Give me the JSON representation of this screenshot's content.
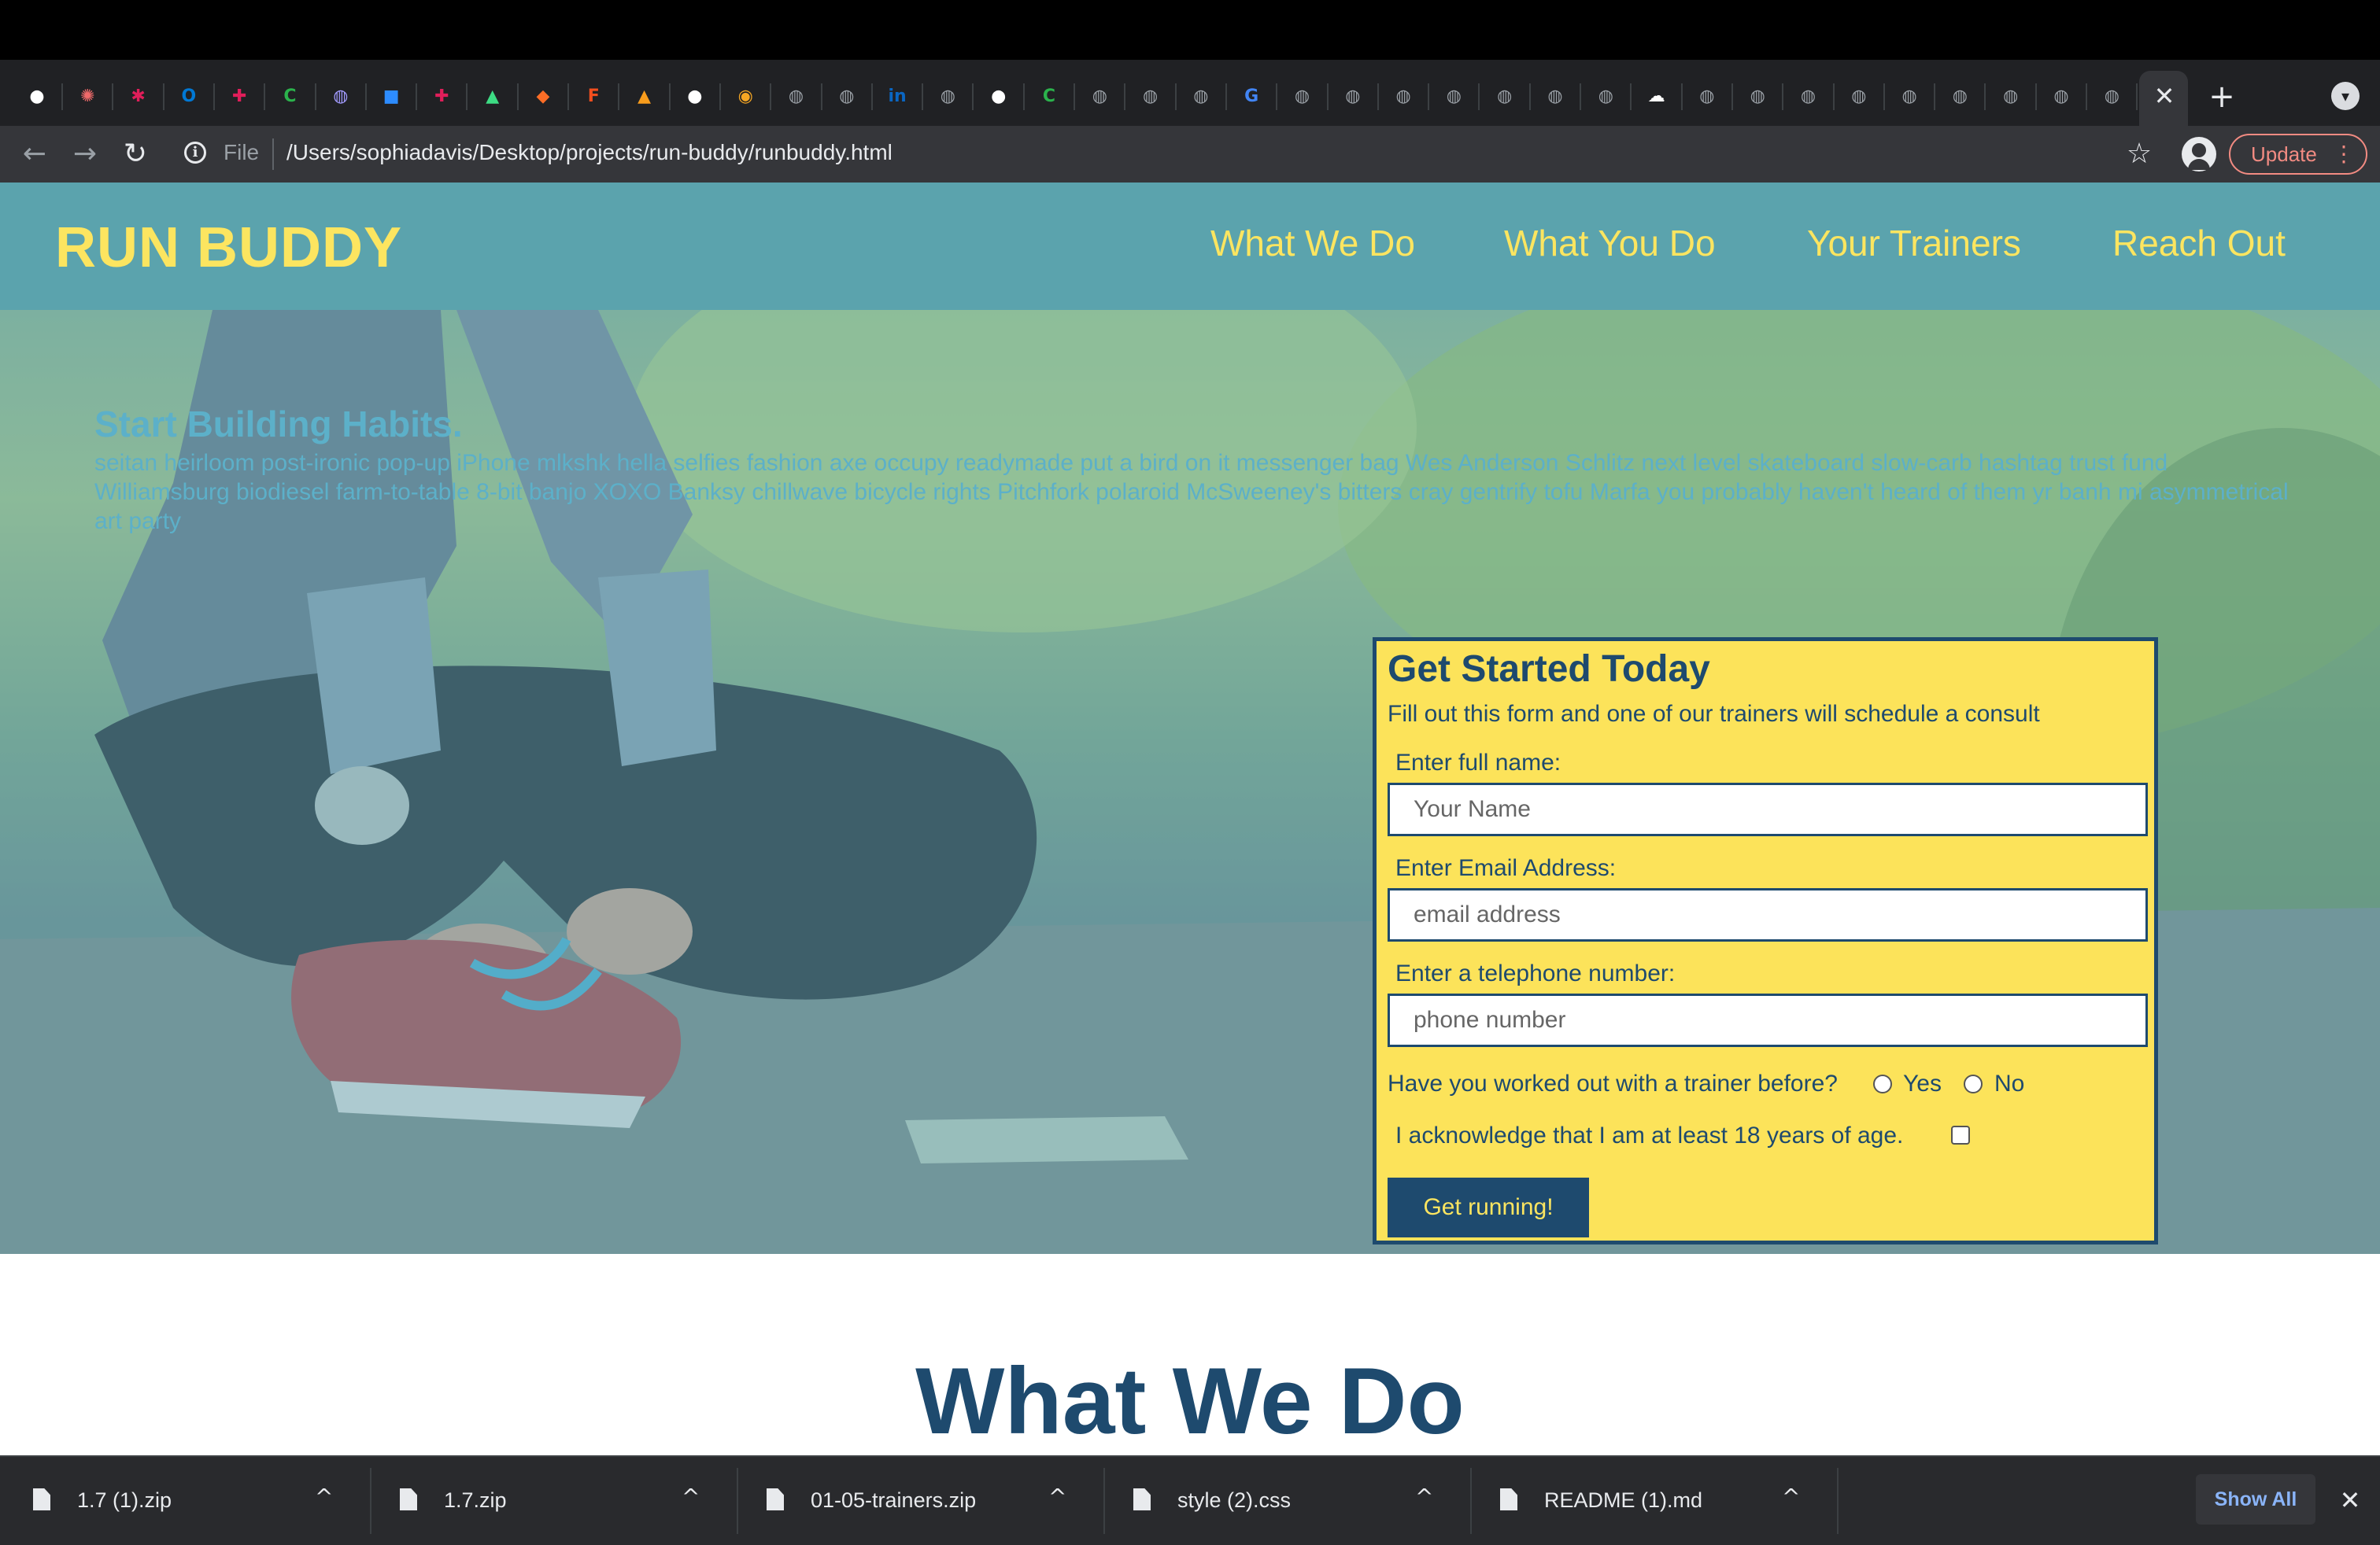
{
  "browser": {
    "tab_icons": [
      "github-icon",
      "asana-icon",
      "asterisk-icon",
      "outlook-icon",
      "slack-icon",
      "c-icon",
      "globe-icon",
      "zoom-icon",
      "slack-icon",
      "android-icon",
      "gitlab-icon",
      "figma-icon",
      "box-icon",
      "github-icon",
      "badge-icon",
      "globe-icon",
      "globe-icon",
      "linkedin-icon",
      "globe-icon",
      "github-icon",
      "c-icon",
      "globe-icon",
      "globe-icon",
      "globe-icon",
      "google-icon",
      "globe-icon",
      "globe-icon",
      "globe-icon",
      "globe-icon",
      "globe-icon",
      "globe-icon",
      "globe-icon",
      "cloud-icon",
      "globe-icon",
      "globe-icon",
      "globe-icon",
      "globe-icon",
      "globe-icon",
      "globe-icon",
      "globe-icon",
      "globe-icon",
      "globe-icon"
    ],
    "tab_colors": [
      "#ffffff",
      "#f06a6a",
      "#e01e5a",
      "#0078d4",
      "#e01e5a",
      "#2bb24c",
      "#a29bfe",
      "#2d8cff",
      "#e01e5a",
      "#3ddc84",
      "#fc6d26",
      "#f24e1e",
      "#f89c1c",
      "#ffffff",
      "#f5a623",
      "#9aa0a6",
      "#9aa0a6",
      "#0a66c2",
      "#9aa0a6",
      "#ffffff",
      "#2bb24c",
      "#9aa0a6",
      "#9aa0a6",
      "#9aa0a6",
      "#4285f4",
      "#9aa0a6",
      "#9aa0a6",
      "#9aa0a6",
      "#9aa0a6",
      "#9aa0a6",
      "#9aa0a6",
      "#9aa0a6",
      "#ffffff",
      "#9aa0a6",
      "#9aa0a6",
      "#9aa0a6",
      "#9aa0a6",
      "#9aa0a6",
      "#9aa0a6",
      "#9aa0a6",
      "#9aa0a6",
      "#9aa0a6"
    ],
    "file_label": "File",
    "url": "/Users/sophiadavis/Desktop/projects/run-buddy/runbuddy.html",
    "update_label": "Update"
  },
  "site": {
    "logo": "RUN BUDDY",
    "nav": [
      "What We Do",
      "What You Do",
      "Your Trainers",
      "Reach Out"
    ]
  },
  "hero": {
    "title": "Start Building Habits.",
    "text": "seitan heirloom post-ironic pop-up iPhone mlkshk hella selfies fashion axe occupy readymade put a bird on it messenger bag Wes Anderson Schlitz next level skateboard slow-carb hashtag trust fund Williamsburg biodiesel farm-to-table 8-bit banjo XOXO Banksy chillwave bicycle rights Pitchfork polaroid McSweeney's bitters cray gentrify tofu Marfa you probably haven't heard of them yr banh mi asymmetrical art party"
  },
  "form": {
    "title": "Get Started Today",
    "subtitle": "Fill out this form and one of our trainers will schedule a consult",
    "name_label": "Enter full name:",
    "name_placeholder": "Your Name",
    "email_label": "Enter Email Address:",
    "email_placeholder": "email address",
    "phone_label": "Enter a telephone number:",
    "phone_placeholder": "phone number",
    "trainer_question": "Have you worked out with a trainer before?",
    "yes_label": "Yes",
    "no_label": "No",
    "ack_label": "I acknowledge that I am at least 18 years of age.",
    "submit_label": "Get running!"
  },
  "section": {
    "title": "What We Do"
  },
  "downloads": {
    "items": [
      "1.7 (1).zip",
      "1.7.zip",
      "01-05-trainers.zip",
      "style (2).css",
      "README (1).md"
    ],
    "show_all": "Show All"
  },
  "colors": {
    "header_bg": "#5ba3ad",
    "accent_yellow": "#fce560",
    "navy": "#1e4a6e"
  }
}
